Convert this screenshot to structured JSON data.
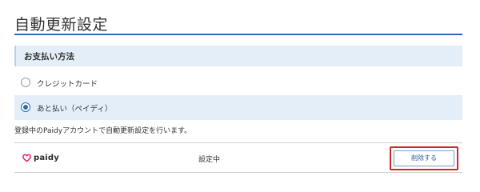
{
  "page": {
    "title": "自動更新設定"
  },
  "payment_section": {
    "header": "お支払い方法",
    "options": [
      {
        "label": "クレジットカード",
        "selected": false
      },
      {
        "label": "あと払い（ペイディ）",
        "selected": true
      }
    ]
  },
  "note": "登録中のPaidyアカウントで自動更新設定を行います。",
  "paidy_account": {
    "logo_text": "paidy",
    "status": "設定中",
    "delete_label": "削除する"
  },
  "colors": {
    "accent": "#2f6bb0",
    "section_bg": "#e3eef9",
    "highlight": "#d8232a",
    "paidy_brand": "#e5196a"
  },
  "icons": {
    "paidy_logo": "paidy-logo-icon",
    "radio_unchecked": "radio-unchecked-icon",
    "radio_checked": "radio-checked-icon"
  }
}
